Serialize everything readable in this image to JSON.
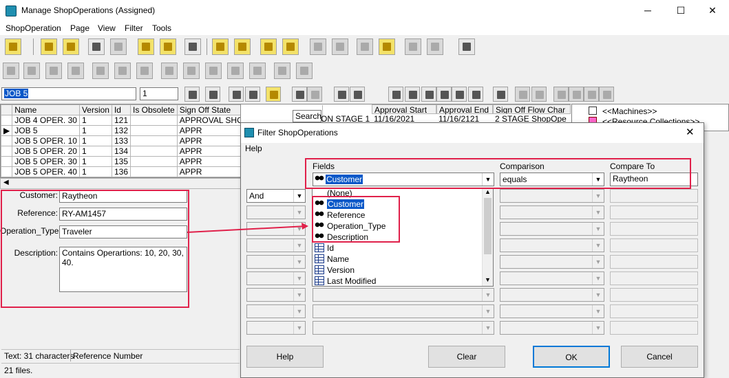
{
  "window": {
    "title": "Manage ShopOperations (Assigned)",
    "minimize": "─",
    "maximize": "☐",
    "close": "✕"
  },
  "menu": [
    {
      "label": "ShopOperation"
    },
    {
      "label": "Page"
    },
    {
      "label": "View"
    },
    {
      "label": "Filter"
    },
    {
      "label": "Tools"
    }
  ],
  "toolbar": {
    "name_value": "JOB 5",
    "count_value": "1"
  },
  "tooltip": "Search",
  "grid": {
    "columns": [
      "Name",
      "Version",
      "Id",
      "Is Obsolete",
      "Sign Off State",
      "Approval Start",
      "Approval End",
      "Sign Off Flow Char"
    ],
    "rows": [
      [
        "JOB 4 OPER. 30",
        "1",
        "121",
        "",
        "APPROVAL SHOPO",
        "ON STAGE 1",
        "11/16/2021",
        "11/16/2121",
        "2 STAGE ShopOpe"
      ],
      [
        "JOB 5",
        "1",
        "132",
        "",
        "APPR",
        "",
        "",
        "",
        ""
      ],
      [
        "JOB 5 OPER. 10",
        "1",
        "133",
        "",
        "APPR",
        "",
        "",
        "",
        ""
      ],
      [
        "JOB 5 OPER. 20",
        "1",
        "134",
        "",
        "APPR",
        "",
        "",
        "",
        ""
      ],
      [
        "JOB 5 OPER. 30",
        "1",
        "135",
        "",
        "APPR",
        "",
        "",
        "",
        ""
      ],
      [
        "JOB 5 OPER. 40",
        "1",
        "136",
        "",
        "APPR",
        "",
        "",
        "",
        ""
      ]
    ]
  },
  "tree": {
    "item1": "<<Machines>>",
    "item2": "<<Resource Collections>>"
  },
  "detail": {
    "customer_label": "Customer:",
    "customer_value": "Raytheon",
    "reference_label": "Reference:",
    "reference_value": "RY-AM1457",
    "optype_label": "Operation_Type:",
    "optype_value": "Traveler",
    "description_label": "Description:",
    "description_value": "Contains Operartions: 10, 20, 30, 40."
  },
  "status": {
    "text": "Text: 31 characters",
    "reference": "Reference Number",
    "files": "21 files."
  },
  "dialog": {
    "title": "Filter ShopOperations",
    "menu_help": "Help",
    "fields_header": "Fields",
    "comparison_header": "Comparison",
    "compare_to_header": "Compare To",
    "field_value": "Customer",
    "comparison_value": "equals",
    "compare_to_value": "Raytheon",
    "logic_value": "And",
    "options": [
      {
        "label": "(None)",
        "icon": "none"
      },
      {
        "label": "Customer",
        "icon": "footprint-icon"
      },
      {
        "label": "Reference",
        "icon": "footprint-icon"
      },
      {
        "label": "Operation_Type",
        "icon": "footprint-icon"
      },
      {
        "label": "Description",
        "icon": "footprint-icon"
      },
      {
        "label": "Id",
        "icon": "table-icon"
      },
      {
        "label": "Name",
        "icon": "table-icon"
      },
      {
        "label": "Version",
        "icon": "table-icon"
      },
      {
        "label": "Last Modified",
        "icon": "table-icon"
      }
    ],
    "buttons": {
      "help": "Help",
      "clear": "Clear",
      "ok": "OK",
      "cancel": "Cancel"
    }
  },
  "colors": {
    "highlight": "#0a58c8",
    "annotation": "#e0204a"
  }
}
